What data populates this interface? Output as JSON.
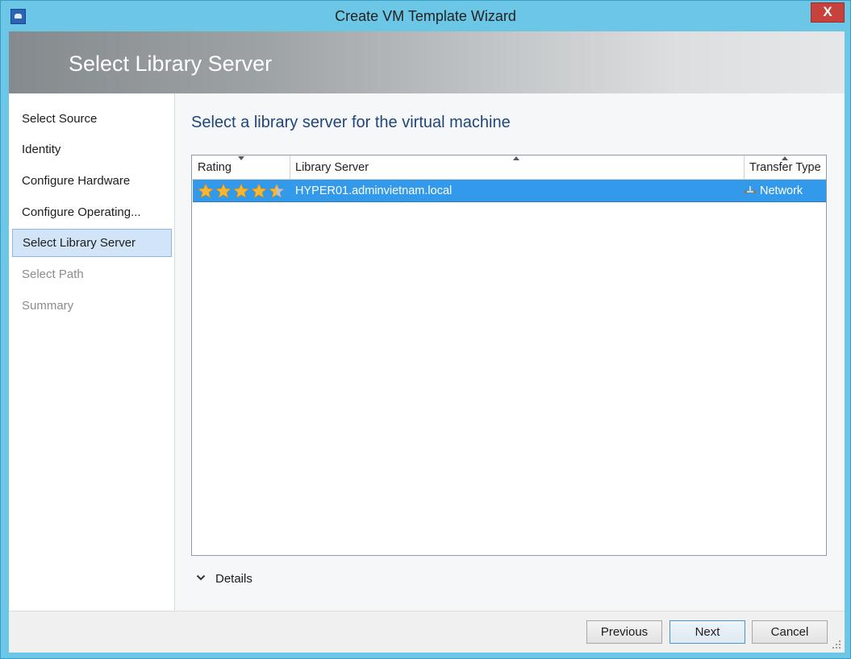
{
  "window": {
    "title": "Create VM Template Wizard",
    "close_label": "X"
  },
  "header": {
    "title": "Select Library Server"
  },
  "sidebar": {
    "items": [
      {
        "label": "Select Source",
        "state": "normal"
      },
      {
        "label": "Identity",
        "state": "normal"
      },
      {
        "label": "Configure Hardware",
        "state": "normal"
      },
      {
        "label": "Configure Operating...",
        "state": "normal"
      },
      {
        "label": "Select Library Server",
        "state": "active"
      },
      {
        "label": "Select Path",
        "state": "disabled"
      },
      {
        "label": "Summary",
        "state": "disabled"
      }
    ]
  },
  "main": {
    "heading": "Select a library server for the virtual machine",
    "grid": {
      "columns": [
        {
          "label": "Rating",
          "sort": "descending"
        },
        {
          "label": "Library Server",
          "sort": "ascending"
        },
        {
          "label": "Transfer Type",
          "sort": "ascending"
        }
      ],
      "rows": [
        {
          "rating": 4.5,
          "rating_max": 5,
          "library_server": "HYPER01.adminvietnam.local",
          "transfer_type": "Network",
          "transfer_icon": "network-icon",
          "selected": true
        }
      ]
    },
    "details_label": "Details"
  },
  "footer": {
    "previous_label": "Previous",
    "next_label": "Next",
    "cancel_label": "Cancel"
  },
  "colors": {
    "accent_border": "#6cc6e6",
    "selection": "#3399ea",
    "heading": "#20467a",
    "close": "#c7423d"
  }
}
